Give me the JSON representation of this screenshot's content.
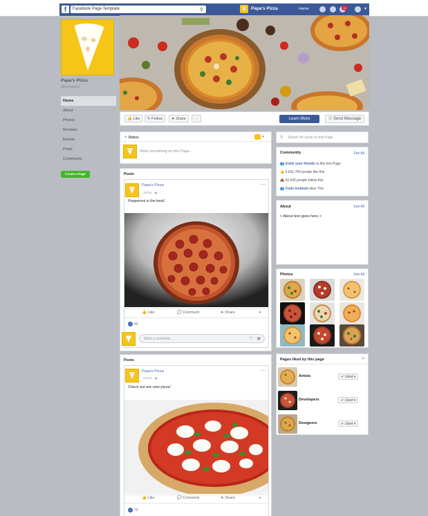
{
  "topbar": {
    "search_value": "Facebook Page Template",
    "brand_name": "Papa's Pizza",
    "home_label": "Home",
    "notif_count": "10",
    "fb_glyph": "f"
  },
  "sidebar": {
    "page_name": "Papa's Pizza",
    "handle": "@company",
    "nav": [
      "Home",
      "About",
      "Photos",
      "Reviews",
      "Events",
      "Posts",
      "Community"
    ],
    "create_label": "Create a Page"
  },
  "actions": {
    "like": "Like",
    "follow": "Follow",
    "share": "Share",
    "more": "···",
    "learn_more": "Learn More",
    "send_message": "Send Message"
  },
  "composer": {
    "status_label": "Status",
    "placeholder": "Write something on this Page..."
  },
  "search_posts": {
    "placeholder": "Search for posts on this Page"
  },
  "community": {
    "title": "Community",
    "see_all": "See All",
    "invite_link": "Invite your friends",
    "invite_rest": " to like this Page",
    "likes": "6,031,769 people like this",
    "follows": "42,042 people follow this",
    "ci_name": "Code Institute",
    "ci_rest": " likes This"
  },
  "about": {
    "title": "About",
    "see_all": "See All",
    "text": "< About text goes here >"
  },
  "photos": {
    "title": "Photos",
    "see_all": "See All"
  },
  "pages_liked": {
    "title": "Pages liked by this page",
    "chevron": ">",
    "items": [
      {
        "name": "Artists",
        "button": "✔ Liked ▾"
      },
      {
        "name": "Developers",
        "button": "✔ Liked ▾"
      },
      {
        "name": "Designers",
        "button": "✔ Liked ▾"
      }
    ]
  },
  "posts": [
    {
      "section_title": "Posts",
      "author": "Papa's Pizza",
      "time": "19 hrs",
      "text": "Pepperoni is the best!",
      "likes": "42",
      "like_label": "Like",
      "comment_label": "Comment",
      "share_label": "Share",
      "comment_placeholder": "Write a comment..."
    },
    {
      "section_title": "Posts",
      "author": "Papa's Pizza",
      "time": "23 hrs",
      "text": "Check out are new pizza!",
      "likes": "73",
      "like_label": "Like",
      "comment_label": "Comment",
      "share_label": "Share"
    }
  ],
  "icons": {
    "globe": "globe-icon",
    "thumbs": "thumbs-up-icon",
    "colors": {
      "facebook_blue": "#3b5998",
      "link_blue": "#4267b2",
      "brand_yellow": "#f5c518",
      "green": "#42b72a"
    }
  }
}
